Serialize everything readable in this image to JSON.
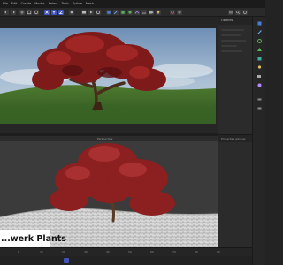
{
  "menubar": {
    "items": [
      "File",
      "Edit",
      "Create",
      "Modes",
      "Select",
      "Tools",
      "Spline",
      "Mesh"
    ]
  },
  "palette": {
    "icons": [
      "cube-icon",
      "pen-icon",
      "gear-icon",
      "tree-icon",
      "stack-icon",
      "light-icon",
      "camera-icon",
      "sphere-icon"
    ]
  },
  "right_panel": {
    "title": "Objects",
    "section": "Properties window"
  },
  "viewport": {
    "label": "Perspective"
  },
  "timeline": {
    "ticks": [
      "0",
      "10",
      "20",
      "30",
      "40",
      "50",
      "60",
      "70",
      "80",
      "90"
    ]
  },
  "overlay": {
    "title": "...werk Plants"
  },
  "colors": {
    "accent": "#3f52b8",
    "foliage": "#8c1f1f",
    "grass": "#3f6b2a",
    "ground": "#d8d8d8"
  }
}
